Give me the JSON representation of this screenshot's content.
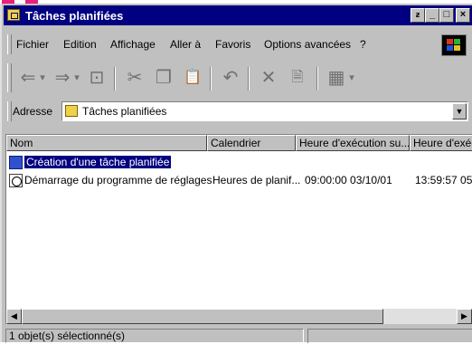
{
  "window": {
    "title": "Tâches planifiées"
  },
  "title_buttons": [
    {
      "name": "extra-button",
      "glyph": "ƶ"
    },
    {
      "name": "minimize-button",
      "glyph": "_"
    },
    {
      "name": "maximize-button",
      "glyph": "□"
    },
    {
      "name": "close-button",
      "glyph": "×"
    }
  ],
  "menu": {
    "items": [
      "Fichier",
      "Edition",
      "Affichage",
      "Aller à",
      "Favoris",
      "Options avancées",
      "?"
    ]
  },
  "toolbar": {
    "buttons": [
      {
        "name": "back-icon",
        "glyph": "⇐"
      },
      {
        "name": "back-dropdown-icon",
        "glyph": "▾"
      },
      {
        "name": "forward-icon",
        "glyph": "⇒"
      },
      {
        "name": "forward-dropdown-icon",
        "glyph": "▾"
      },
      {
        "name": "up-folder-icon",
        "glyph": "⊡"
      },
      {
        "name": "cut-icon",
        "glyph": "✂"
      },
      {
        "name": "copy-icon",
        "glyph": "❐"
      },
      {
        "name": "paste-icon",
        "glyph": "📋"
      },
      {
        "name": "undo-icon",
        "glyph": "↶"
      },
      {
        "name": "delete-icon",
        "glyph": "✕"
      },
      {
        "name": "properties-icon",
        "glyph": "🗎"
      },
      {
        "name": "views-icon",
        "glyph": "▦"
      },
      {
        "name": "views-dropdown-icon",
        "glyph": "▾"
      }
    ]
  },
  "address": {
    "label": "Adresse",
    "value": "Tâches planifiées"
  },
  "list": {
    "columns": [
      "Nom",
      "Calendrier",
      "Heure d'exécution su...",
      "Heure d'exéc"
    ],
    "rows": [
      {
        "name": "Création d'une tâche planifiée",
        "schedule": "",
        "next_run": "",
        "last_run": "",
        "selected": true
      },
      {
        "name": "Démarrage du programme de réglages",
        "schedule": "Heures de planif...",
        "next_run": "09:00:00  03/10/01",
        "last_run": "13:59:57  05/",
        "selected": false
      }
    ]
  },
  "status": {
    "text": "1 objet(s) sélectionné(s)"
  },
  "colors": {
    "titlebar": "#000080",
    "face": "#c0c0c0",
    "accent_pink": "#e8207a"
  }
}
